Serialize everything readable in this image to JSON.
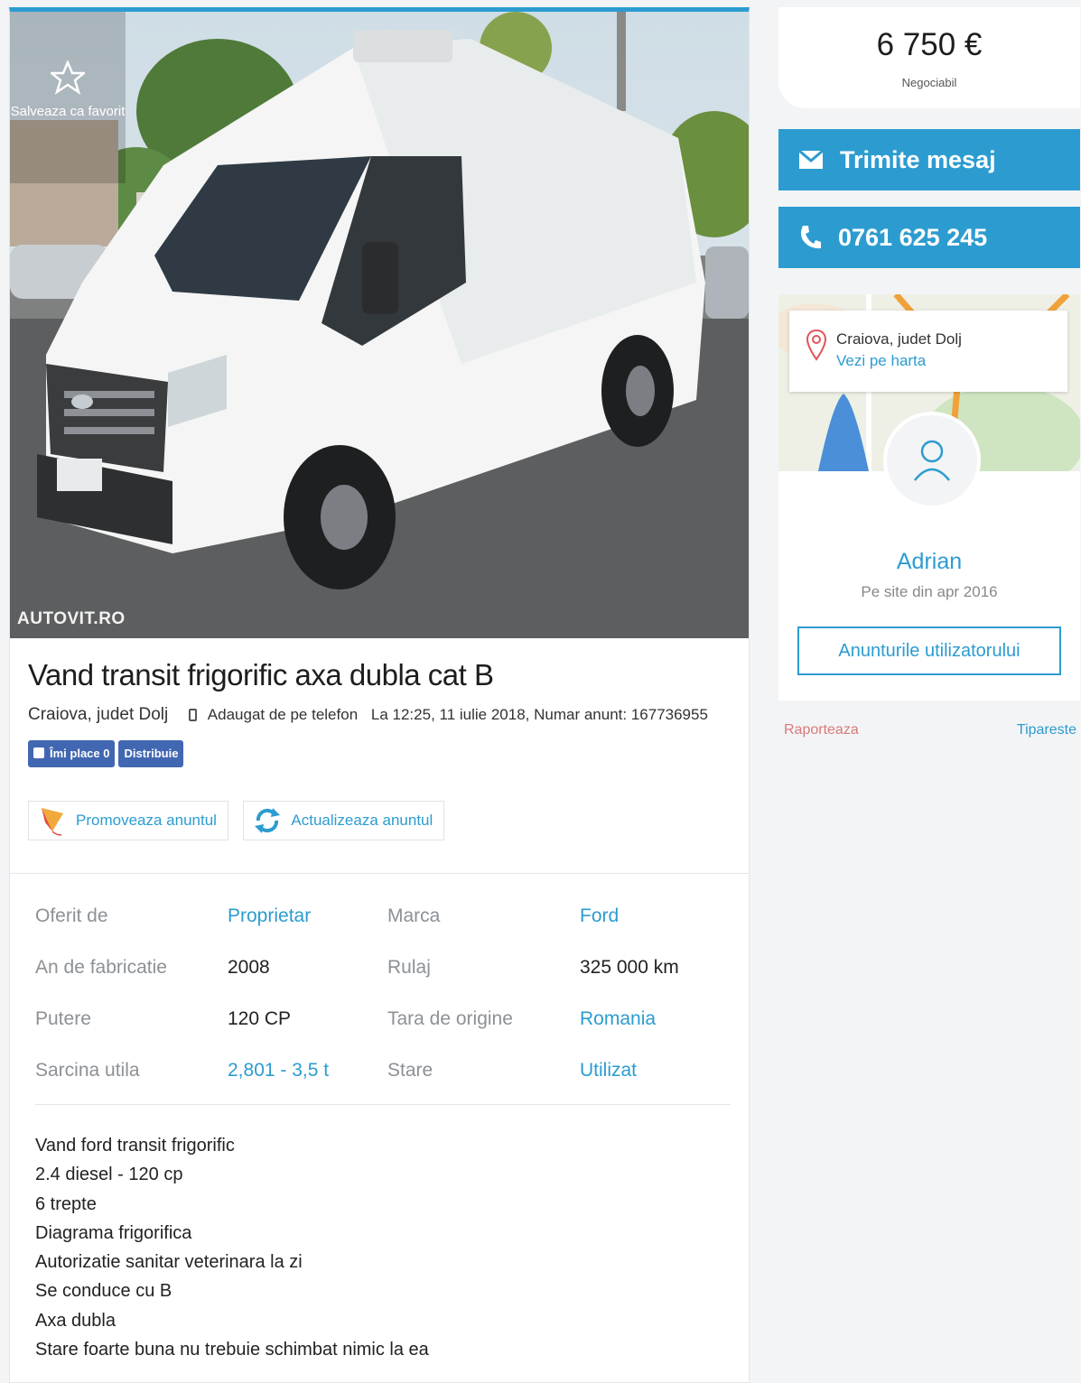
{
  "listing": {
    "title": "Vand transit frigorific axa dubla cat B",
    "location": "Craiova, judet Dolj",
    "added_from": "Adaugat de pe telefon",
    "date_info": "La 12:25, 11 iulie 2018, Numar anunt: 167736955",
    "watermark": "AUTOVIT.RO",
    "favorite_label": "Salveaza ca favorit"
  },
  "social": {
    "like_label": "Îmi place 0",
    "share_label": "Distribuie"
  },
  "actions": {
    "promote": "Promoveaza anuntul",
    "refresh": "Actualizeaza anuntul"
  },
  "specs": [
    {
      "label1": "Oferit de",
      "value1": "Proprietar",
      "label2": "Marca",
      "value2": "Ford"
    },
    {
      "label1": "An de fabricatie",
      "value1": "2008",
      "label2": "Rulaj",
      "value2": "325 000 km"
    },
    {
      "label1": "Putere",
      "value1": "120 CP",
      "label2": "Tara de origine",
      "value2": "Romania"
    },
    {
      "label1": "Sarcina utila",
      "value1": "2,801 - 3,5 t",
      "label2": "Stare",
      "value2": "Utilizat"
    }
  ],
  "description": [
    "Vand ford transit frigorific",
    "2.4 diesel - 120 cp",
    "6 trepte",
    "Diagrama frigorifica",
    "Autorizatie sanitar veterinara la zi",
    "Se conduce cu B",
    "Axa dubla",
    "Stare foarte buna nu trebuie schimbat nimic la ea"
  ],
  "sidebar": {
    "price": "6 750 €",
    "negotiable": "Negociabil",
    "message_button": "Trimite mesaj",
    "phone": "0761 625 245",
    "map_city": "Craiova, judet Dolj",
    "map_link": "Vezi pe harta",
    "user_name": "Adrian",
    "member_since": "Pe site din apr 2016",
    "user_ads_button": "Anunturile utilizatorului",
    "report": "Raporteaza",
    "print": "Tipareste"
  },
  "colors": {
    "accent": "#2c9cd0",
    "facebook": "#4267b2",
    "report": "#d97a7a"
  }
}
